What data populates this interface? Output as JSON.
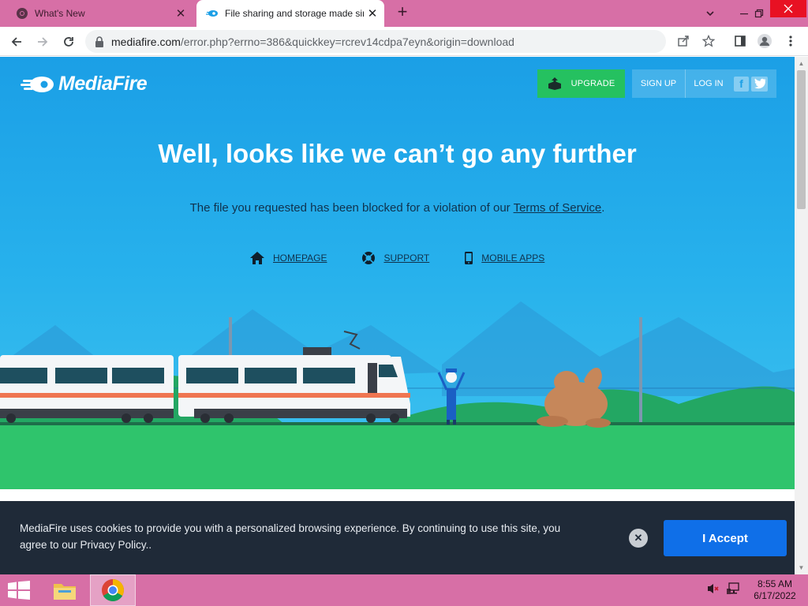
{
  "browser": {
    "tabs": [
      {
        "title": "What's New",
        "icon": "chrome-icon"
      },
      {
        "title": "File sharing and storage made simple",
        "icon": "mediafire-icon"
      }
    ],
    "new_tab_label": "+",
    "url_domain": "mediafire.com",
    "url_path": "/error.php?errno=386&quickkey=rcrev14cdpa7eyn&origin=download"
  },
  "header": {
    "logo_text": "MediaFire",
    "upgrade_label": "UPGRADE",
    "signup_label": "SIGN UP",
    "login_label": "LOG IN",
    "facebook_glyph": "f",
    "twitter_glyph": "t"
  },
  "main": {
    "headline": "Well, looks like we can’t go any further",
    "message_before": "The file you requested has been blocked for a violation of our ",
    "tos_link": "Terms of Service",
    "message_after": ".",
    "links": [
      {
        "label": "HOMEPAGE",
        "icon": "home-icon"
      },
      {
        "label": "SUPPORT",
        "icon": "lifebuoy-icon"
      },
      {
        "label": "MOBILE APPS",
        "icon": "phone-icon"
      }
    ]
  },
  "cookie": {
    "message": "MediaFire uses cookies to provide you with a personalized browsing experience. By continuing to use this site, you agree to our Privacy Policy..",
    "close_glyph": "✕",
    "accept_label": "I Accept"
  },
  "taskbar": {
    "time": "8:55 AM",
    "date": "6/17/2022"
  },
  "colors": {
    "sky": "#1b9fe6",
    "grass": "#2fc46c",
    "upgrade": "#25c160",
    "accept": "#0f6fe8",
    "cookie_bg": "#1f2a38",
    "tabstrip": "#d76fa6"
  }
}
